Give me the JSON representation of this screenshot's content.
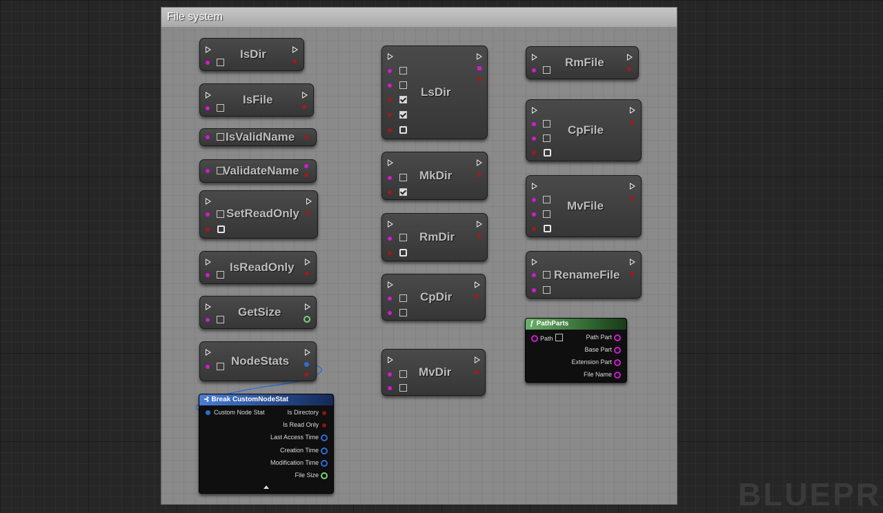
{
  "comment": {
    "title": "File system"
  },
  "watermark": "BLUEPRI",
  "nodes": {
    "isdir": "IsDir",
    "isfile": "IsFile",
    "isvalidname": "IsValidName",
    "validatename": "ValidateName",
    "setreadonly": "SetReadOnly",
    "isreadonly": "IsReadOnly",
    "getsize": "GetSize",
    "nodestats": "NodeStats",
    "lsdir": "LsDir",
    "mkdir": "MkDir",
    "rmdir": "RmDir",
    "cpdir": "CpDir",
    "mvdir": "MvDir",
    "rmfile": "RmFile",
    "cpfile": "CpFile",
    "mvfile": "MvFile",
    "renamefile": "RenameFile"
  },
  "break_node": {
    "title": "Break CustomNodeStat",
    "input": "Custom Node Stat",
    "outputs": [
      "Is Directory",
      "Is Read Only",
      "Last Access Time",
      "Creation Time",
      "Modification Time",
      "File Size"
    ]
  },
  "pathparts_node": {
    "title": "PathParts",
    "input": "Path",
    "outputs": [
      "Path Part",
      "Base Part",
      "Extension Part",
      "File Name"
    ]
  },
  "colors": {
    "string_pin": "#d21ad2",
    "bool_pin": "#a11a1a",
    "struct_pin": "#2c6fd6",
    "int_pin": "#7fd27f",
    "pure_header": "#6ab26a",
    "break_header": "#4a7ed6"
  },
  "icons": [
    "exec-pin-icon",
    "function-icon",
    "break-struct-icon",
    "collapse-arrow-icon"
  ]
}
